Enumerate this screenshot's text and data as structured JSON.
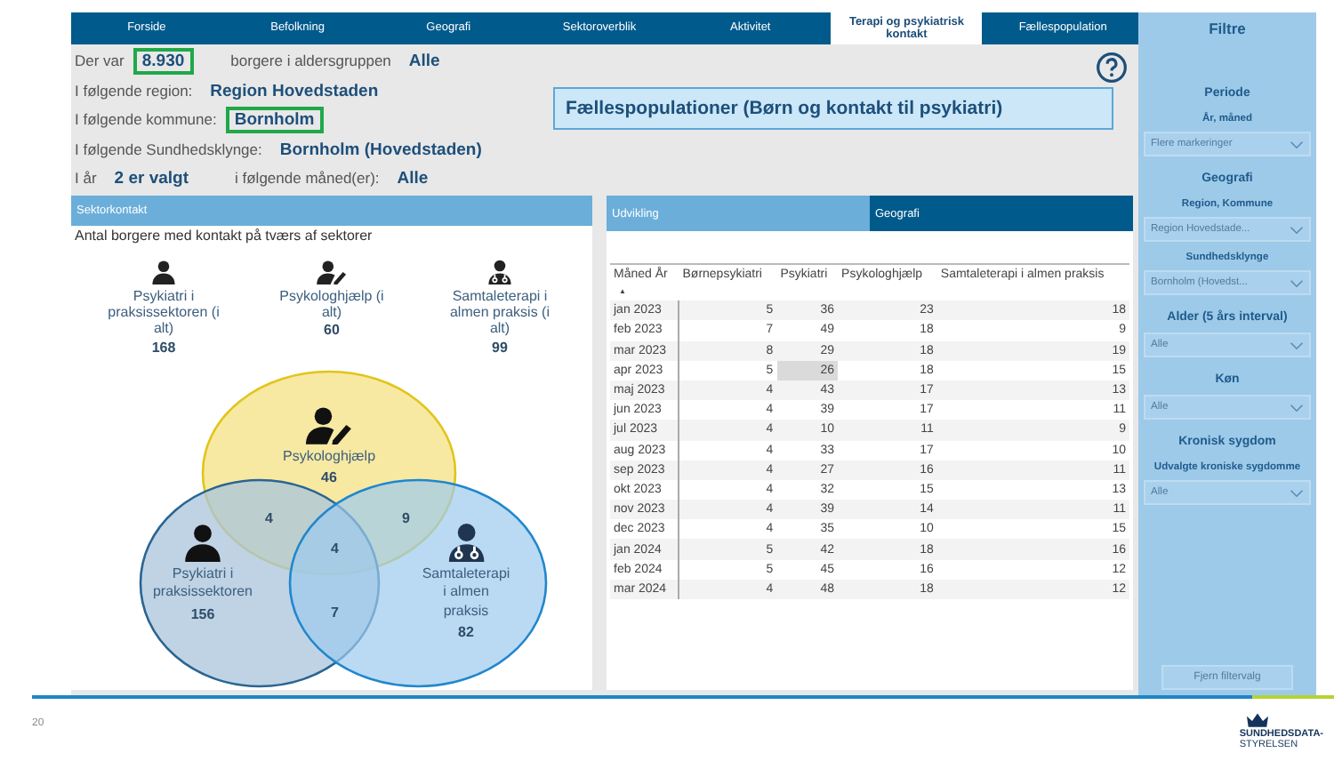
{
  "nav_tabs": [
    {
      "label": "Forside",
      "selected": false
    },
    {
      "label": "Befolkning",
      "selected": false
    },
    {
      "label": "Geografi",
      "selected": false
    },
    {
      "label": "Sektoroverblik",
      "selected": false
    },
    {
      "label": "Aktivitet",
      "selected": false
    },
    {
      "label": "Terapi og psykiatrisk kontakt",
      "selected": true
    },
    {
      "label": "Fællespopulation",
      "selected": false
    }
  ],
  "info_lines": [
    [
      {
        "label": "Der var",
        "value": "8.930",
        "highlighted": true
      },
      {
        "label": "borgere i aldersgruppen",
        "value": "Alle",
        "highlighted": false
      }
    ],
    [
      {
        "label": "I følgende region:",
        "value": "Region Hovedstaden",
        "highlighted": false
      }
    ],
    [
      {
        "label": "I følgende kommune:",
        "value": "Bornholm",
        "highlighted": true
      }
    ],
    [
      {
        "label": "I følgende Sundhedsklynge:",
        "value": "Bornholm (Hovedstaden)",
        "highlighted": false
      }
    ],
    [
      {
        "label": "I år",
        "value": "2 er valgt",
        "highlighted": false
      },
      {
        "label": "i følgende måned(er):",
        "value": "Alle",
        "highlighted": false
      }
    ]
  ],
  "page_title": "Fællespopulationer (Børn og kontakt til psykiatri)",
  "sector_panel": {
    "title": "Sektorkontakt",
    "subtitle": "Antal borgere med kontakt på tværs af sektorer",
    "totals": [
      {
        "kind": "person",
        "label": "Psykiatri i praksissektoren (i alt)",
        "value": "168"
      },
      {
        "kind": "pen",
        "label": "Psykologhjælp (i alt)",
        "value": "60"
      },
      {
        "kind": "doctor",
        "label": "Samtaleterapi i almen praksis (i alt)",
        "value": "99"
      }
    ],
    "venn": {
      "sets": [
        {
          "kind": "pen",
          "label": "Psykologhjælp",
          "value": "46"
        },
        {
          "kind": "person",
          "label": "Psykiatri i praksissektoren",
          "value": "156"
        },
        {
          "kind": "doctor",
          "label": "Samtaleterapi i almen praksis",
          "value": "82"
        }
      ],
      "overlaps": [
        "4",
        "9",
        "4",
        "7"
      ]
    }
  },
  "table_panel": {
    "tabs": [
      {
        "label": "Udvikling",
        "selected": false
      },
      {
        "label": "Geografi",
        "selected": true
      }
    ],
    "columns": [
      "Måned År",
      "Børnepsykiatri",
      "Psykiatri",
      "Psykologhjælp",
      "Samtaleterapi i almen praksis"
    ],
    "sort_mark": "▲",
    "rows": [
      {
        "cells": [
          "jan 2023",
          "5",
          "36",
          "23",
          "18"
        ],
        "hovered": false
      },
      {
        "cells": [
          "feb 2023",
          "7",
          "49",
          "18",
          "9"
        ],
        "hovered": false
      },
      {
        "cells": [
          "mar 2023",
          "8",
          "29",
          "18",
          "19"
        ],
        "hovered": false
      },
      {
        "cells": [
          "apr 2023",
          "5",
          "26",
          "18",
          "15"
        ],
        "hovered": true
      },
      {
        "cells": [
          "maj 2023",
          "4",
          "43",
          "17",
          "13"
        ],
        "hovered": false
      },
      {
        "cells": [
          "jun 2023",
          "4",
          "39",
          "17",
          "11"
        ],
        "hovered": false
      },
      {
        "cells": [
          "jul 2023",
          "4",
          "10",
          "11",
          "9"
        ],
        "hovered": false
      },
      {
        "cells": [
          "aug 2023",
          "4",
          "33",
          "17",
          "10"
        ],
        "hovered": false
      },
      {
        "cells": [
          "sep 2023",
          "4",
          "27",
          "16",
          "11"
        ],
        "hovered": false
      },
      {
        "cells": [
          "okt 2023",
          "4",
          "32",
          "15",
          "13"
        ],
        "hovered": false
      },
      {
        "cells": [
          "nov 2023",
          "4",
          "39",
          "14",
          "11"
        ],
        "hovered": false
      },
      {
        "cells": [
          "dec 2023",
          "4",
          "35",
          "10",
          "15"
        ],
        "hovered": false
      },
      {
        "cells": [
          "jan 2024",
          "5",
          "42",
          "18",
          "16"
        ],
        "hovered": false
      },
      {
        "cells": [
          "feb 2024",
          "5",
          "45",
          "16",
          "12"
        ],
        "hovered": false
      },
      {
        "cells": [
          "mar 2024",
          "4",
          "48",
          "18",
          "12"
        ],
        "hovered": false
      }
    ]
  },
  "filters": {
    "title": "Filtre",
    "items": [
      {
        "kind": "heading",
        "text": "Periode"
      },
      {
        "kind": "subheading",
        "text": "År, måned"
      },
      {
        "kind": "dropdown",
        "text": "Flere markeringer"
      },
      {
        "kind": "heading",
        "text": "Geografi"
      },
      {
        "kind": "subheading",
        "text": "Region, Kommune"
      },
      {
        "kind": "dropdown",
        "text": "Region Hovedstade..."
      },
      {
        "kind": "subheading",
        "text": "Sundhedsklynge"
      },
      {
        "kind": "dropdown",
        "text": "Bornholm (Hovedst..."
      },
      {
        "kind": "heading",
        "text": "Alder (5 års interval)"
      },
      {
        "kind": "dropdown",
        "text": "Alle"
      },
      {
        "kind": "heading",
        "text": "Køn"
      },
      {
        "kind": "dropdown",
        "text": "Alle"
      },
      {
        "kind": "heading",
        "text": "Kronisk sygdom"
      },
      {
        "kind": "subheading",
        "text": "Udvalgte kroniske sygdomme"
      },
      {
        "kind": "dropdown",
        "text": "Alle"
      }
    ],
    "button": "Fjern filtervalg"
  },
  "footer": {
    "page_number": "20",
    "logo_lines": [
      "SUNDHEDSDATA-",
      "STYRELSEN"
    ]
  }
}
